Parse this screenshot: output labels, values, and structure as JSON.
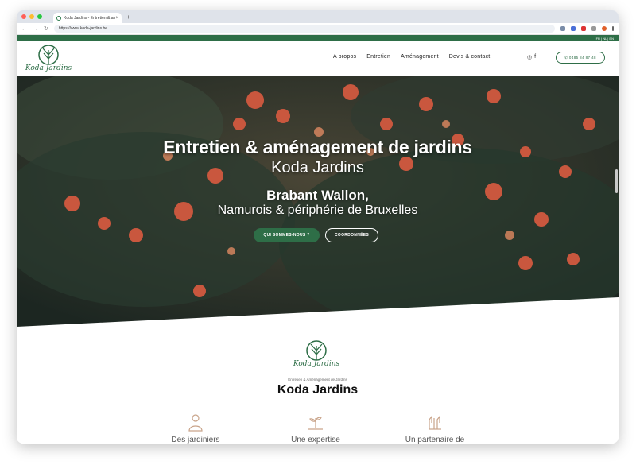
{
  "browser": {
    "tab_title": "Koda Jardins - Entretien & am",
    "tab_close": "×",
    "new_tab": "+",
    "url": "https://www.koda-jardins.be",
    "back": "←",
    "forward": "→",
    "reload": "↻"
  },
  "topbar": {
    "languages": "FR | NL | EN"
  },
  "header": {
    "logo_text": "Koda Jardins",
    "nav": [
      "A propos",
      "Entretien",
      "Aménagement",
      "Devis & contact"
    ],
    "social": [
      "◎",
      "f"
    ],
    "phone": "0485 84 87 48"
  },
  "hero": {
    "title": "Entretien & aménagement de jardins",
    "subtitle": "Koda Jardins",
    "region_bold": "Brabant Wallon,",
    "region": "Namurois & périphérie de Bruxelles",
    "btn_about": "QUI SOMMES-NOUS ?",
    "btn_contact": "COORDONNÉES"
  },
  "intro": {
    "logo_text": "Koda Jardins",
    "tagline": "Entretien & Aménagement de Jardins",
    "title": "Koda Jardins",
    "features": [
      "Des jardiniers",
      "Une expertise",
      "Un partenaire de"
    ]
  },
  "colors": {
    "brand": "#2e6e47"
  }
}
